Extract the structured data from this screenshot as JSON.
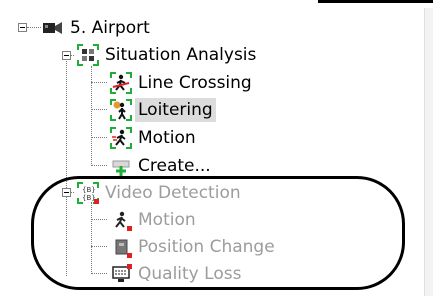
{
  "tree": {
    "root": {
      "label": "5. Airport",
      "icon": "camera-icon",
      "expanded": true
    },
    "situation_analysis": {
      "label": "Situation Analysis",
      "icon": "situation-analysis-icon",
      "expanded": true,
      "children": [
        {
          "label": "Line Crossing",
          "icon": "line-crossing-icon"
        },
        {
          "label": "Loitering",
          "icon": "loitering-icon",
          "selected": true
        },
        {
          "label": "Motion",
          "icon": "motion-icon"
        },
        {
          "label": "Create...",
          "icon": "create-icon"
        }
      ]
    },
    "video_detection": {
      "label": "Video Detection",
      "icon": "video-detection-icon",
      "expanded": true,
      "disabled": true,
      "children": [
        {
          "label": "Motion",
          "icon": "motion-icon"
        },
        {
          "label": "Position Change",
          "icon": "position-change-icon"
        },
        {
          "label": "Quality Loss",
          "icon": "quality-loss-icon"
        }
      ]
    }
  },
  "colors": {
    "selection": "#dcdcdc",
    "disabled_text": "#9c9c9c",
    "corner_green": "#1fae3a",
    "status_red": "#e02020",
    "icon_orange": "#e69a2a"
  }
}
